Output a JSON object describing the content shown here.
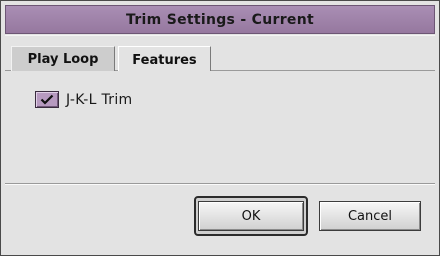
{
  "window": {
    "title": "Trim Settings - Current"
  },
  "tabs": [
    {
      "label": "Play Loop",
      "selected": false
    },
    {
      "label": "Features",
      "selected": true
    }
  ],
  "features": {
    "jkl_trim": {
      "label": "J-K-L Trim",
      "checked": true
    }
  },
  "buttons": {
    "ok_label": "OK",
    "cancel_label": "Cancel"
  },
  "colors": {
    "accent": "#9c7fa6",
    "checkbox": "#b79ac0",
    "background": "#e3e3e3"
  }
}
